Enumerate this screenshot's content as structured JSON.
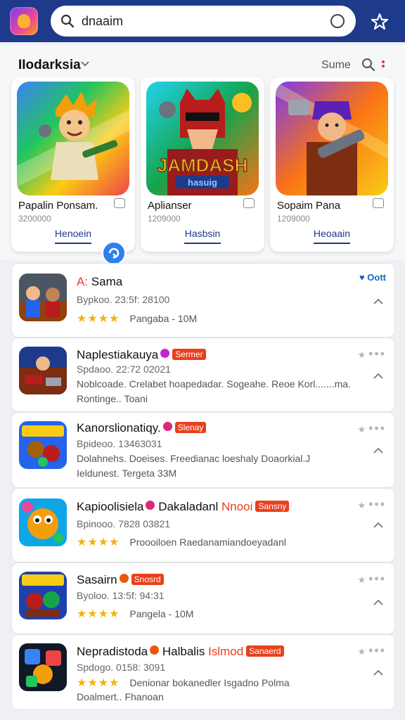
{
  "search": {
    "query": "dnaaim"
  },
  "section": {
    "title": "IIodarksia",
    "sort": "Sume"
  },
  "featured": [
    {
      "name": "Papalin Ponsam.",
      "number": "3200000",
      "link": "Henoein"
    },
    {
      "name": "Aplianser",
      "number": "1209000",
      "link": "Hasbsin",
      "art_text": "JAMDASH",
      "art_sub": "hasuig"
    },
    {
      "name": "Sopaim Pana",
      "number": "1209000",
      "link": "Heoaain"
    }
  ],
  "list": [
    {
      "title_prefix": "A:",
      "title": "Sama",
      "line2": "Bypkoo. 23:5f: 28100",
      "stars": "★★★★",
      "line3": "Pangaba - 10M",
      "right": "Oott",
      "right_color": "#1565c0"
    },
    {
      "title": "Naplestiakauya",
      "tag": "Sermer",
      "dot_color": "#c026d3",
      "line2": "Spdaoo. 22:72 02021",
      "line3": "Noblcoade. Crelabet hoapedadar. Sogeahe. Reoe Korl.......ma.",
      "line4": "Rontinge.. Toani"
    },
    {
      "title": "Kanorslionatiqy.",
      "tag": "Slenay",
      "dot_color": "#db2777",
      "line2": "Bpideoo. 13463031",
      "line3": "Dolahnehs. Doeises. Freedianac loeshaly Doaorkial.J",
      "line4": "Ieldunest. Tergeta 33M"
    },
    {
      "title": "Kapioolisiela",
      "title_extra": "Dakaladanl",
      "red_text": "Nnooi",
      "tag": "Sansny",
      "dot_color": "#db2777",
      "line2": "Bpinooo. 7828 03821",
      "stars": "★★★★",
      "line3": "Proooiloen Raedanamiandoeyadanl"
    },
    {
      "title": "Sasairn",
      "tag": "Snosrd",
      "dot_color": "#ea580c",
      "line2": "Byoloo. 13:5f: 94:31",
      "stars": "★★★★",
      "line3": "Pangela - 10M"
    },
    {
      "title": "Nepradistoda",
      "title_extra": "Halbalis",
      "red_text": "Islmod",
      "tag": "Sanaerd",
      "dot_color": "#ea580c",
      "line2": "Spdogo. 0158: 3091",
      "stars": "★★★★",
      "line3": "Denionar bokanedler Isgadno Polma",
      "line4": "Doalmert.. Fhanoan"
    }
  ],
  "colors": {
    "topbar": "#1e3a8a",
    "accent_red": "#e8401c",
    "star": "#f5b301",
    "link": "#1e3a8a"
  }
}
